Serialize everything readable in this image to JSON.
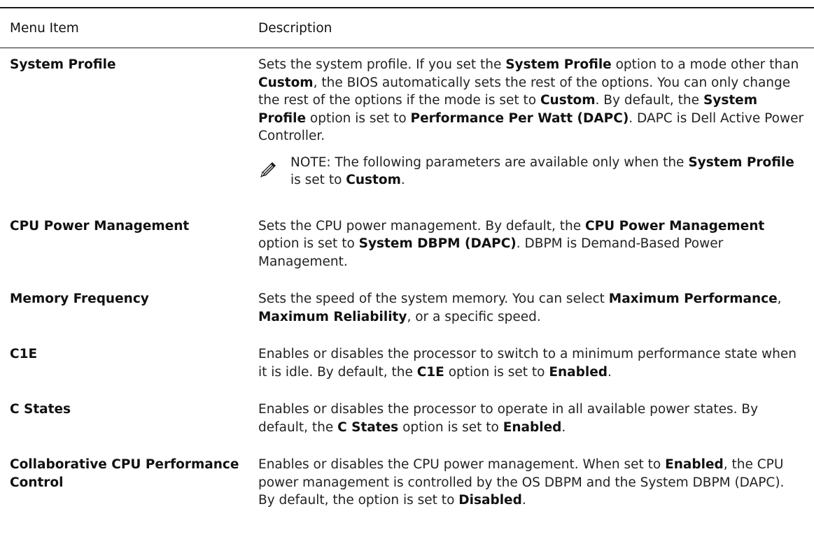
{
  "table": {
    "header": {
      "col1": "Menu Item",
      "col2": "Description"
    },
    "rows": [
      {
        "item": "System Profile",
        "description": [
          {
            "t": "Sets the system profile. If you set the ",
            "b": false
          },
          {
            "t": "System Profile",
            "b": true
          },
          {
            "t": " option to a mode other than ",
            "b": false
          },
          {
            "t": "Custom",
            "b": true
          },
          {
            "t": ", the BIOS automatically sets the rest of the options. You can only change the rest of the options if the mode is set to ",
            "b": false
          },
          {
            "t": "Custom",
            "b": true
          },
          {
            "t": ". By default, the ",
            "b": false
          },
          {
            "t": "System Profile",
            "b": true
          },
          {
            "t": " option is set to ",
            "b": false
          },
          {
            "t": "Performance Per Watt (DAPC)",
            "b": true
          },
          {
            "t": ". DAPC is Dell Active Power Controller.",
            "b": false
          }
        ],
        "note": [
          {
            "t": "NOTE: The following parameters are available only when the ",
            "b": false
          },
          {
            "t": "System Profile",
            "b": true
          },
          {
            "t": " is set to ",
            "b": false
          },
          {
            "t": "Custom",
            "b": true
          },
          {
            "t": ".",
            "b": false
          }
        ]
      },
      {
        "item": "CPU Power Management",
        "description": [
          {
            "t": "Sets the CPU power management. By default, the ",
            "b": false
          },
          {
            "t": "CPU Power Management",
            "b": true
          },
          {
            "t": " option is set to ",
            "b": false
          },
          {
            "t": "System DBPM (DAPC)",
            "b": true
          },
          {
            "t": ". DBPM is Demand-Based Power Management.",
            "b": false
          }
        ]
      },
      {
        "item": "Memory Frequency",
        "description": [
          {
            "t": "Sets the speed of the system memory. You can select ",
            "b": false
          },
          {
            "t": "Maximum Performance",
            "b": true
          },
          {
            "t": ", ",
            "b": false
          },
          {
            "t": "Maximum Reliability",
            "b": true
          },
          {
            "t": ", or a specific speed.",
            "b": false
          }
        ]
      },
      {
        "item": "C1E",
        "description": [
          {
            "t": "Enables or disables the processor to switch to a minimum performance state when it is idle. By default, the ",
            "b": false
          },
          {
            "t": "C1E",
            "b": true
          },
          {
            "t": " option is set to ",
            "b": false
          },
          {
            "t": "Enabled",
            "b": true
          },
          {
            "t": ".",
            "b": false
          }
        ]
      },
      {
        "item": "C States",
        "description": [
          {
            "t": "Enables or disables the processor to operate in all available power states. By default, the ",
            "b": false
          },
          {
            "t": "C States",
            "b": true
          },
          {
            "t": " option is set to ",
            "b": false
          },
          {
            "t": "Enabled",
            "b": true
          },
          {
            "t": ".",
            "b": false
          }
        ]
      },
      {
        "item": "Collaborative CPU Performance Control",
        "description": [
          {
            "t": "Enables or disables the CPU power management. When set to ",
            "b": false
          },
          {
            "t": "Enabled",
            "b": true
          },
          {
            "t": ", the CPU power management is controlled by the OS DBPM and the System DBPM (DAPC). By default, the option is set to ",
            "b": false
          },
          {
            "t": "Disabled",
            "b": true
          },
          {
            "t": ".",
            "b": false
          }
        ]
      }
    ],
    "note_icon": "pencil-note-icon"
  }
}
